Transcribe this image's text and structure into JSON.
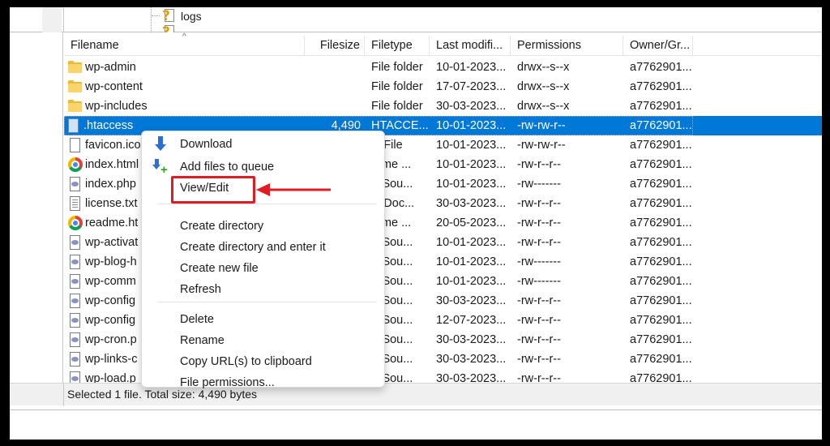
{
  "tree": {
    "item_label": "logs"
  },
  "columns": {
    "filename": "Filename",
    "filesize": "Filesize",
    "filetype": "Filetype",
    "modified": "Last modifi...",
    "permissions": "Permissions",
    "owner": "Owner/Gr..."
  },
  "files": [
    {
      "name": "wp-admin",
      "size": "",
      "type": "File folder",
      "modified": "10-01-2023...",
      "perm": "drwx--s--x",
      "owner": "a7762901...",
      "icon": "folder-icon"
    },
    {
      "name": "wp-content",
      "size": "",
      "type": "File folder",
      "modified": "17-07-2023...",
      "perm": "drwx--s--x",
      "owner": "a7762901...",
      "icon": "folder-icon"
    },
    {
      "name": "wp-includes",
      "size": "",
      "type": "File folder",
      "modified": "30-03-2023...",
      "perm": "drwx--s--x",
      "owner": "a7762901...",
      "icon": "folder-icon"
    },
    {
      "name": ".htaccess",
      "size": "4,490",
      "type": "HTACCE...",
      "modified": "10-01-2023...",
      "perm": "-rw-rw-r--",
      "owner": "a7762901...",
      "icon": "file-icon",
      "selected": true
    },
    {
      "name": "favicon.ico",
      "size": "",
      "type": "O File",
      "modified": "10-01-2023...",
      "perm": "-rw-rw-r--",
      "owner": "a7762901...",
      "icon": "file-icon"
    },
    {
      "name": "index.html",
      "size": "",
      "type": "rome ...",
      "modified": "10-01-2023...",
      "perm": "-rw-r--r--",
      "owner": "a7762901...",
      "icon": "chrome-icon"
    },
    {
      "name": "index.php",
      "size": "",
      "type": "P Sou...",
      "modified": "10-01-2023...",
      "perm": "-rw-------",
      "owner": "a7762901...",
      "icon": "php-file-icon"
    },
    {
      "name": "license.txt",
      "size": "",
      "type": "xt Doc...",
      "modified": "30-03-2023...",
      "perm": "-rw-r--r--",
      "owner": "a7762901...",
      "icon": "text-file-icon"
    },
    {
      "name": "readme.ht",
      "size": "",
      "type": "rome ...",
      "modified": "20-05-2023...",
      "perm": "-rw-r--r--",
      "owner": "a7762901...",
      "icon": "chrome-icon"
    },
    {
      "name": "wp-activat",
      "size": "",
      "type": "P Sou...",
      "modified": "10-01-2023...",
      "perm": "-rw-r--r--",
      "owner": "a7762901...",
      "icon": "php-file-icon"
    },
    {
      "name": "wp-blog-h",
      "size": "",
      "type": "P Sou...",
      "modified": "10-01-2023...",
      "perm": "-rw-------",
      "owner": "a7762901...",
      "icon": "php-file-icon"
    },
    {
      "name": "wp-comm",
      "size": "",
      "type": "P Sou...",
      "modified": "10-01-2023...",
      "perm": "-rw-------",
      "owner": "a7762901...",
      "icon": "php-file-icon"
    },
    {
      "name": "wp-config",
      "size": "",
      "type": "P Sou...",
      "modified": "30-03-2023...",
      "perm": "-rw-r--r--",
      "owner": "a7762901...",
      "icon": "php-file-icon"
    },
    {
      "name": "wp-config",
      "size": "",
      "type": "P Sou...",
      "modified": "12-07-2023...",
      "perm": "-rw-r--r--",
      "owner": "a7762901...",
      "icon": "php-file-icon"
    },
    {
      "name": "wp-cron.p",
      "size": "",
      "type": "P Sou...",
      "modified": "30-03-2023...",
      "perm": "-rw-r--r--",
      "owner": "a7762901...",
      "icon": "php-file-icon"
    },
    {
      "name": "wp-links-c",
      "size": "",
      "type": "P Sou...",
      "modified": "30-03-2023...",
      "perm": "-rw-r--r--",
      "owner": "a7762901...",
      "icon": "php-file-icon"
    },
    {
      "name": "wp-load.p",
      "size": "",
      "type": "P Sou...",
      "modified": "30-03-2023...",
      "perm": "-rw-r--r--",
      "owner": "a7762901...",
      "icon": "php-file-icon"
    }
  ],
  "status": {
    "text": "Selected 1 file. Total size: 4,490 bytes"
  },
  "context_menu": {
    "download": "Download",
    "add_to_queue": "Add files to queue",
    "view_edit": "View/Edit",
    "create_directory": "Create directory",
    "create_directory_enter": "Create directory and enter it",
    "create_new_file": "Create new file",
    "refresh": "Refresh",
    "delete": "Delete",
    "rename": "Rename",
    "copy_urls": "Copy URL(s) to clipboard",
    "file_permissions": "File permissions..."
  },
  "colors": {
    "selection": "#0078d7",
    "highlight": "#e11b22"
  }
}
